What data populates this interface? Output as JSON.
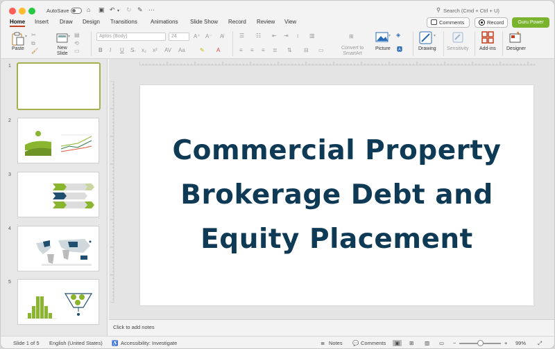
{
  "titlebar": {
    "autosave_label": "AutoSave",
    "search_placeholder": "Search (Cmd + Ctrl + U)"
  },
  "tabs": [
    "Home",
    "Insert",
    "Draw",
    "Design",
    "Transitions",
    "Animations",
    "Slide Show",
    "Record",
    "Review",
    "View"
  ],
  "top_buttons": {
    "comments": "Comments",
    "record": "Record",
    "guru": "Guru Power"
  },
  "ribbon": {
    "paste": "Paste",
    "new_slide_1": "New",
    "new_slide_2": "Slide",
    "font_name": "Aptos (Body)",
    "font_size": "24",
    "convert_1": "Convert to",
    "convert_2": "SmartArt",
    "picture": "Picture",
    "drawing": "Drawing",
    "sensitivity": "Sensitivity",
    "addins": "Add-ins",
    "designer": "Designer"
  },
  "thumbnails": [
    {
      "num": "1"
    },
    {
      "num": "2"
    },
    {
      "num": "3"
    },
    {
      "num": "4"
    },
    {
      "num": "5"
    }
  ],
  "slide": {
    "title_line1": "Commercial Property",
    "title_line2": "Brokerage Debt and",
    "title_line3": "Equity Placement"
  },
  "notes_placeholder": "Click to add notes",
  "status": {
    "slide_of": "Slide 1 of 5",
    "language": "English (United States)",
    "accessibility": "Accessibility: Investigate",
    "notes": "Notes",
    "comments": "Comments",
    "zoom": "99%"
  },
  "colors": {
    "accent_tab": "#c43e1c",
    "guru": "#7ab32e",
    "title": "#0e3a55",
    "thumb_sel": "#a5b04a"
  }
}
